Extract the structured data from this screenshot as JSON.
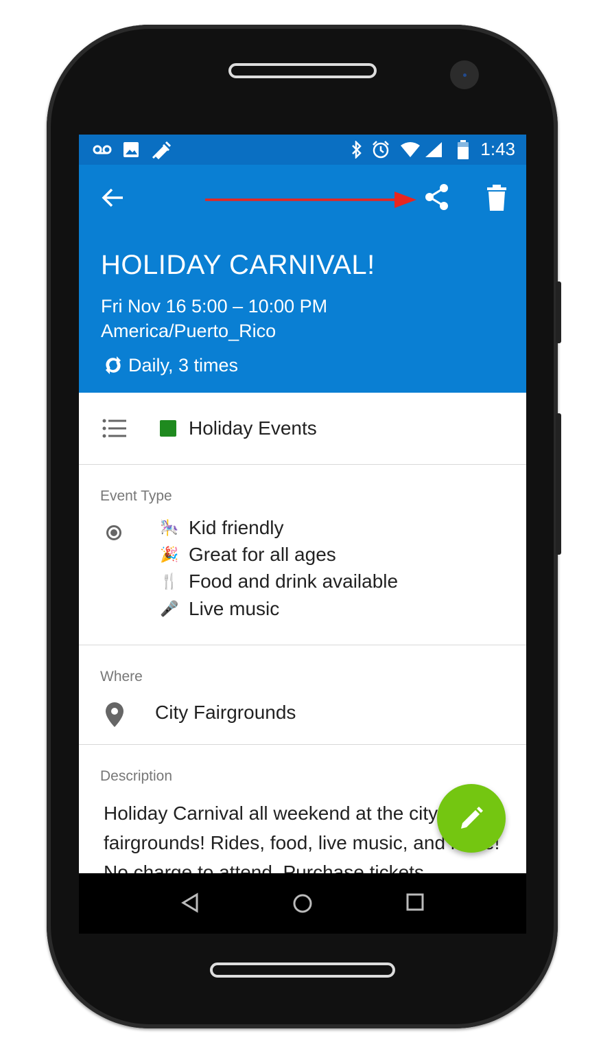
{
  "status_bar": {
    "time": "1:43",
    "left_icons": [
      "voicemail-icon",
      "image-icon",
      "syringe-icon"
    ],
    "right_icons": [
      "bluetooth-icon",
      "alarm-icon",
      "wifi-icon",
      "signal-icon",
      "battery-icon"
    ]
  },
  "app_bar": {
    "actions": [
      "back-arrow-icon",
      "share-icon",
      "trash-icon"
    ],
    "annotation_arrow_color": "#e8261f"
  },
  "event": {
    "title": "HOLIDAY CARNIVAL!",
    "datetime": "Fri Nov 16 5:00 – 10:00 PM",
    "timezone": "America/Puerto_Rico",
    "recurrence": "Daily, 3 times"
  },
  "calendar": {
    "name": "Holiday Events",
    "color": "#1f8a1f"
  },
  "event_type": {
    "label": "Event Type",
    "items": [
      {
        "emoji": "🎠",
        "text": "Kid friendly"
      },
      {
        "emoji": "🎉",
        "text": "Great for all ages"
      },
      {
        "emoji": "🍴",
        "text": "Food and drink available"
      },
      {
        "emoji": "🎤",
        "text": "Live music"
      }
    ]
  },
  "where": {
    "label": "Where",
    "place": "City Fairgrounds"
  },
  "description": {
    "label": "Description",
    "text": "Holiday Carnival all weekend at the city fairgrounds! Rides, food, live music, and more! No charge to attend. Purchase tickets"
  },
  "colors": {
    "appbar": "#0a7fd3",
    "statusbar": "#0a6fc2",
    "fab": "#74c611"
  }
}
